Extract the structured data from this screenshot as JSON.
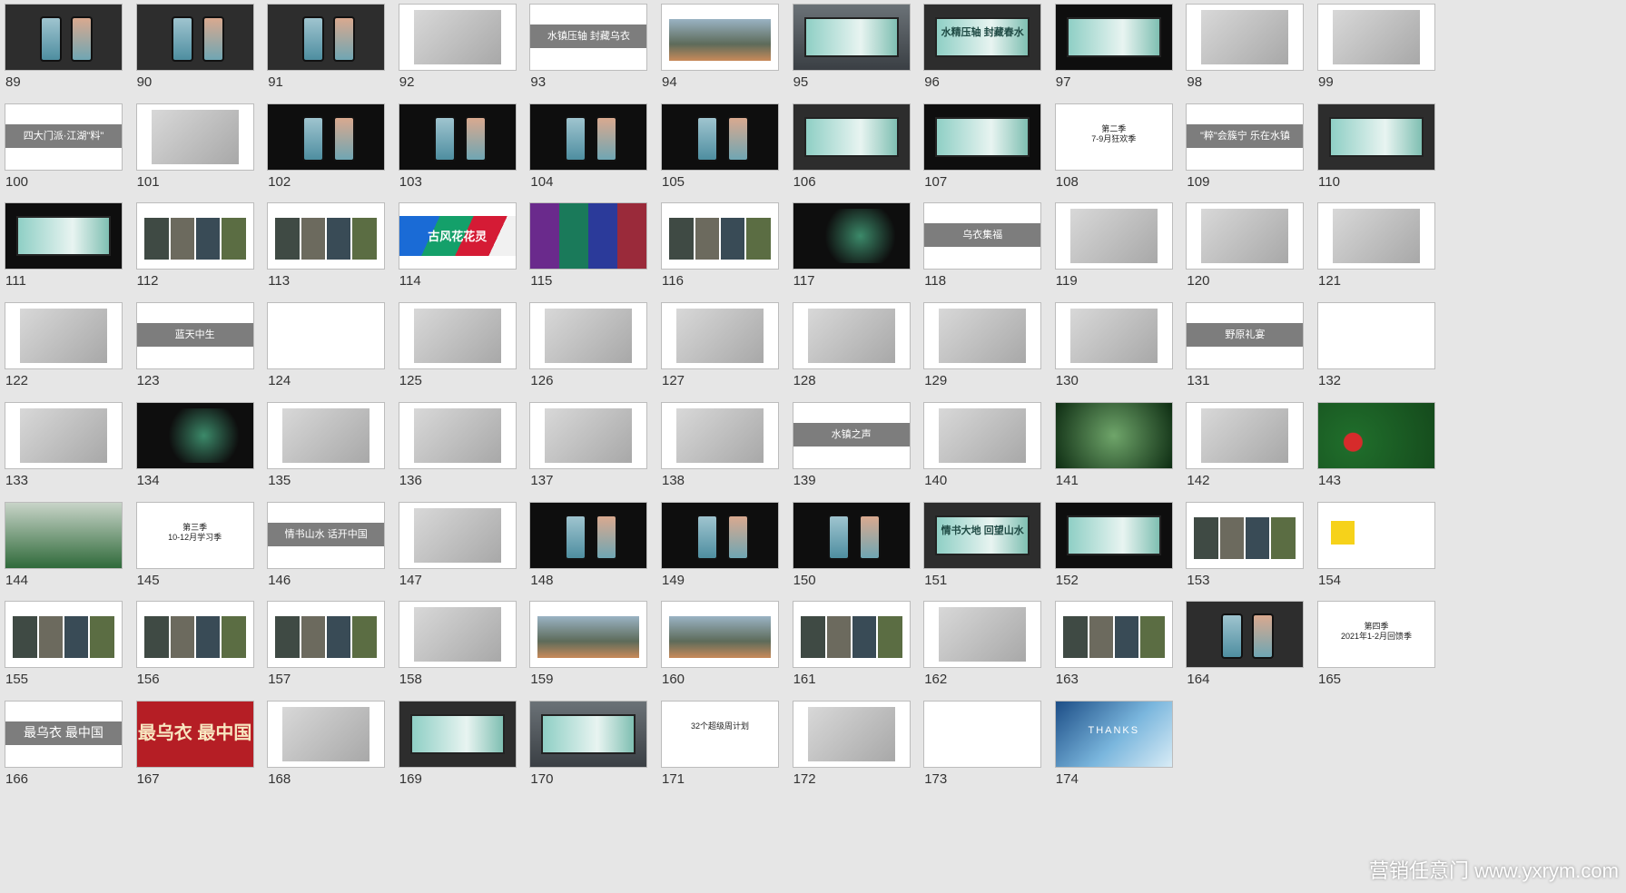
{
  "slides": [
    {
      "num": "89",
      "kind": "phones-dark"
    },
    {
      "num": "90",
      "kind": "phones-dark"
    },
    {
      "num": "91",
      "kind": "phones-dark"
    },
    {
      "num": "92",
      "kind": "balloon"
    },
    {
      "num": "93",
      "kind": "band",
      "text": "水镇压轴 封藏乌衣"
    },
    {
      "num": "94",
      "kind": "landscape"
    },
    {
      "num": "95",
      "kind": "billboard-gray"
    },
    {
      "num": "96",
      "kind": "banner-dark",
      "text": "水精压轴 封藏春水"
    },
    {
      "num": "97",
      "kind": "billboard-dark"
    },
    {
      "num": "98",
      "kind": "cars"
    },
    {
      "num": "99",
      "kind": "bird"
    },
    {
      "num": "100",
      "kind": "band",
      "text": "四大门派·江湖\"料\""
    },
    {
      "num": "101",
      "kind": "illustration"
    },
    {
      "num": "102",
      "kind": "phones-black"
    },
    {
      "num": "103",
      "kind": "phones-black"
    },
    {
      "num": "104",
      "kind": "phones-black"
    },
    {
      "num": "105",
      "kind": "phones-black"
    },
    {
      "num": "106",
      "kind": "banner-dark"
    },
    {
      "num": "107",
      "kind": "billboard-dark"
    },
    {
      "num": "108",
      "kind": "text",
      "text": "第二季\n7-9月狂欢季"
    },
    {
      "num": "109",
      "kind": "band",
      "text": "\"粹\"会簇宁 乐在水镇"
    },
    {
      "num": "110",
      "kind": "banner-dark"
    },
    {
      "num": "111",
      "kind": "billboard-dark"
    },
    {
      "num": "112",
      "kind": "collage"
    },
    {
      "num": "113",
      "kind": "collage"
    },
    {
      "num": "114",
      "kind": "stripes",
      "text": "古风花花灵"
    },
    {
      "num": "115",
      "kind": "colorblocks"
    },
    {
      "num": "116",
      "kind": "mosaic"
    },
    {
      "num": "117",
      "kind": "black-art"
    },
    {
      "num": "118",
      "kind": "band",
      "text": "乌衣集福"
    },
    {
      "num": "119",
      "kind": "product"
    },
    {
      "num": "120",
      "kind": "product"
    },
    {
      "num": "121",
      "kind": "product"
    },
    {
      "num": "122",
      "kind": "product"
    },
    {
      "num": "123",
      "kind": "band",
      "text": "蓝天中生"
    },
    {
      "num": "124",
      "kind": "blank"
    },
    {
      "num": "125",
      "kind": "envelope"
    },
    {
      "num": "126",
      "kind": "envelope"
    },
    {
      "num": "127",
      "kind": "envelope"
    },
    {
      "num": "128",
      "kind": "envelope"
    },
    {
      "num": "129",
      "kind": "envelope"
    },
    {
      "num": "130",
      "kind": "bag"
    },
    {
      "num": "131",
      "kind": "band",
      "text": "野原礼宴"
    },
    {
      "num": "132",
      "kind": "blank"
    },
    {
      "num": "133",
      "kind": "room"
    },
    {
      "num": "134",
      "kind": "room-black"
    },
    {
      "num": "135",
      "kind": "cards"
    },
    {
      "num": "136",
      "kind": "jar"
    },
    {
      "num": "137",
      "kind": "jar"
    },
    {
      "num": "138",
      "kind": "cards"
    },
    {
      "num": "139",
      "kind": "band",
      "text": "水镇之声"
    },
    {
      "num": "140",
      "kind": "logo"
    },
    {
      "num": "141",
      "kind": "green-logo"
    },
    {
      "num": "142",
      "kind": "wall"
    },
    {
      "num": "143",
      "kind": "strawberries"
    },
    {
      "num": "144",
      "kind": "greenhouse"
    },
    {
      "num": "145",
      "kind": "text",
      "text": "第三季\n10-12月学习季"
    },
    {
      "num": "146",
      "kind": "band",
      "text": "情书山水 话开中国"
    },
    {
      "num": "147",
      "kind": "ink"
    },
    {
      "num": "148",
      "kind": "phones-black"
    },
    {
      "num": "149",
      "kind": "phones-black"
    },
    {
      "num": "150",
      "kind": "phones-black"
    },
    {
      "num": "151",
      "kind": "banner-dark",
      "text": "情书大地 回望山水"
    },
    {
      "num": "152",
      "kind": "billboard-dark"
    },
    {
      "num": "153",
      "kind": "collage"
    },
    {
      "num": "154",
      "kind": "yellow"
    },
    {
      "num": "155",
      "kind": "event"
    },
    {
      "num": "156",
      "kind": "event"
    },
    {
      "num": "157",
      "kind": "event"
    },
    {
      "num": "158",
      "kind": "diagram"
    },
    {
      "num": "159",
      "kind": "mountains"
    },
    {
      "num": "160",
      "kind": "mountains"
    },
    {
      "num": "161",
      "kind": "collage"
    },
    {
      "num": "162",
      "kind": "pattern"
    },
    {
      "num": "163",
      "kind": "collage"
    },
    {
      "num": "164",
      "kind": "phones-dark"
    },
    {
      "num": "165",
      "kind": "text",
      "text": "第四季\n2021年1-2月回馈季"
    },
    {
      "num": "166",
      "kind": "band-big",
      "text": "最乌衣 最中国"
    },
    {
      "num": "167",
      "kind": "red",
      "text": "最乌衣 最中国"
    },
    {
      "num": "168",
      "kind": "street"
    },
    {
      "num": "169",
      "kind": "banner-dark"
    },
    {
      "num": "170",
      "kind": "billboard-gray"
    },
    {
      "num": "171",
      "kind": "text",
      "text": "32个超级周计划"
    },
    {
      "num": "172",
      "kind": "table"
    },
    {
      "num": "173",
      "kind": "text",
      "text": ""
    },
    {
      "num": "174",
      "kind": "thanks",
      "text": "THANKS"
    }
  ],
  "watermark": "营销任意门 www.yxrym.com"
}
